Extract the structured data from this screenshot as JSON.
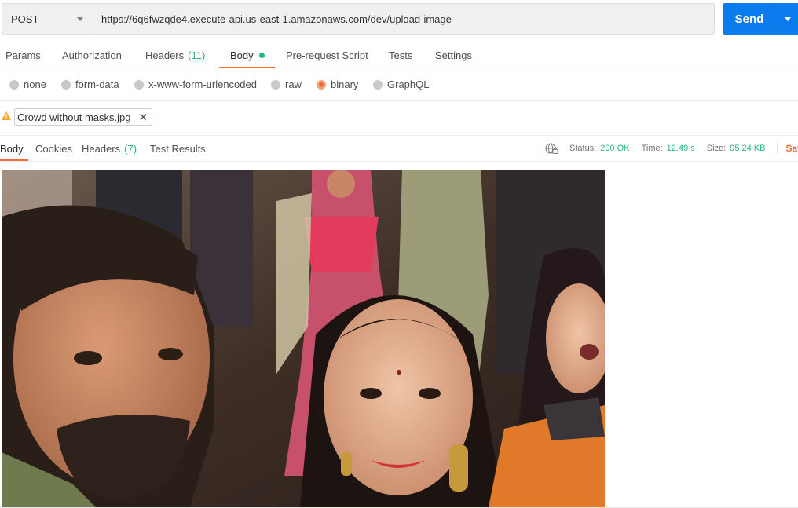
{
  "request": {
    "method": "POST",
    "url": "https://6q6fwzqde4.execute-api.us-east-1.amazonaws.com/dev/upload-image",
    "send_label": "Send"
  },
  "request_tabs": [
    {
      "label": "Params"
    },
    {
      "label": "Authorization"
    },
    {
      "label": "Headers",
      "count": "(11)"
    },
    {
      "label": "Body",
      "active": true
    },
    {
      "label": "Pre-request Script"
    },
    {
      "label": "Tests"
    },
    {
      "label": "Settings"
    }
  ],
  "body_types": [
    {
      "label": "none"
    },
    {
      "label": "form-data"
    },
    {
      "label": "x-www-form-urlencoded"
    },
    {
      "label": "raw"
    },
    {
      "label": "binary",
      "selected": true
    },
    {
      "label": "GraphQL"
    }
  ],
  "file": {
    "name": "Crowd without masks.jpg",
    "warning_icon": "warning-icon",
    "remove_icon": "close-icon"
  },
  "response_tabs": [
    {
      "label": "Body",
      "active": true
    },
    {
      "label": "Cookies"
    },
    {
      "label": "Headers",
      "count": "(7)"
    },
    {
      "label": "Test Results"
    }
  ],
  "response_status": {
    "status_label": "Status:",
    "status_value": "200 OK",
    "time_label": "Time:",
    "time_value": "12.49 s",
    "size_label": "Size:",
    "size_value": "95.24 KB",
    "save_label": "Sav"
  },
  "colors": {
    "accent": "#f26b3a",
    "send": "#097bed",
    "success": "#26b47f"
  }
}
